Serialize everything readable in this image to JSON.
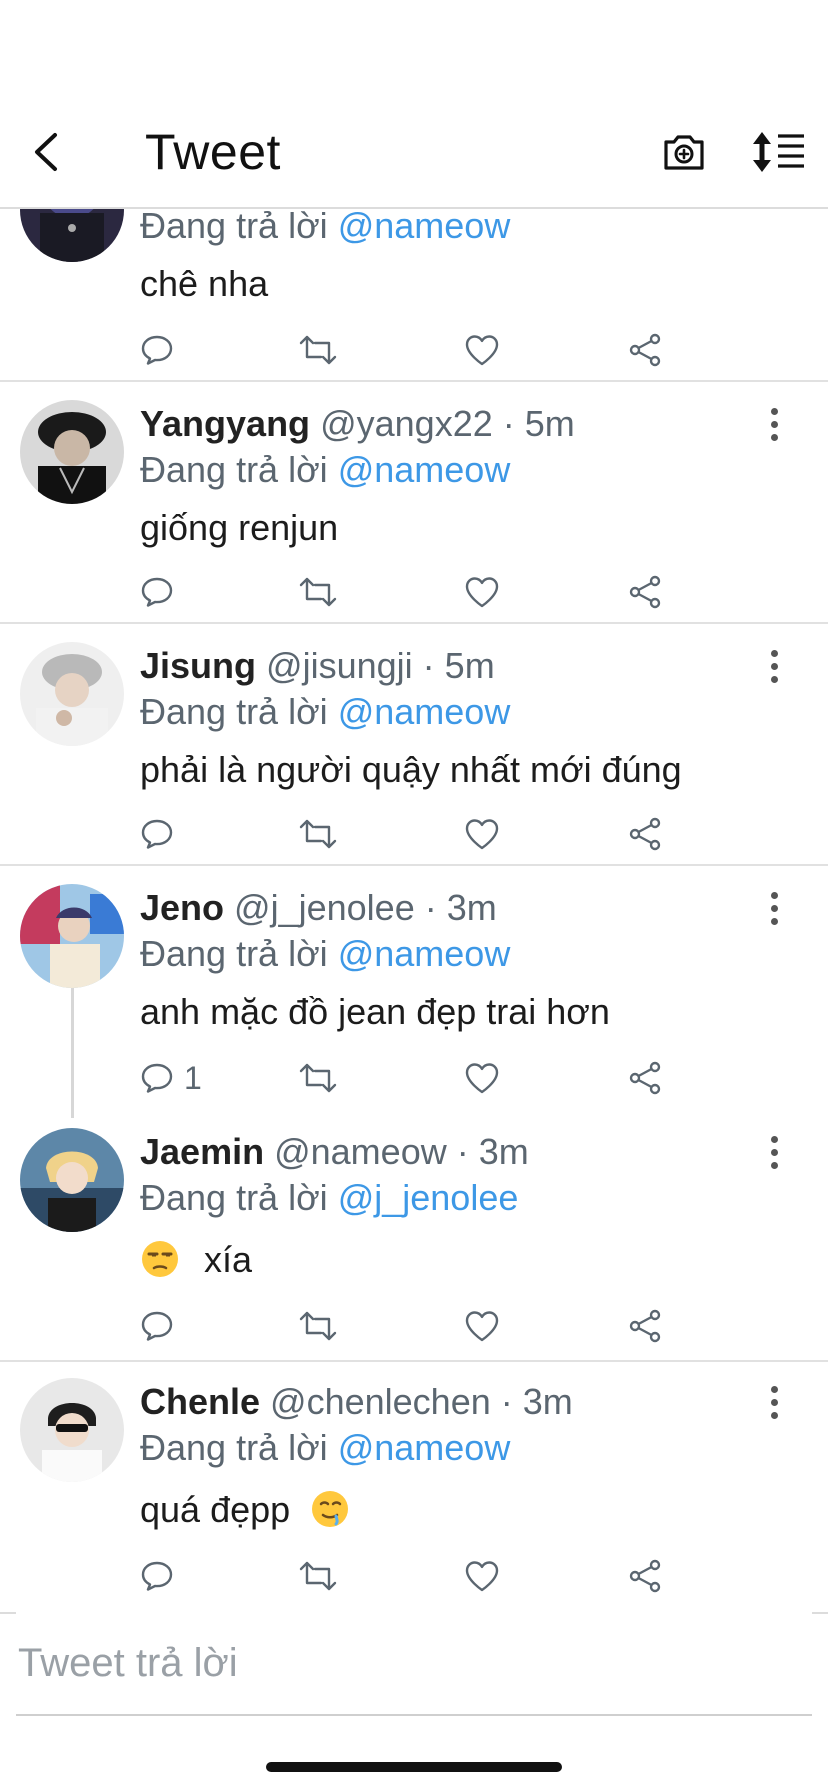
{
  "header": {
    "title": "Tweet"
  },
  "icons": {
    "back": "chevron-left-icon",
    "camera": "camera-plus-icon",
    "sort": "sort-list-icon"
  },
  "colors": {
    "accent": "#3d98e6",
    "muted": "#5b6670",
    "divider": "#e1e1e1"
  },
  "tweets": [
    {
      "name": "",
      "handle": "",
      "time": "",
      "reply_prefix": "Đang trả lời",
      "reply_to": "@nameow",
      "text": "chê nha",
      "replies": ""
    },
    {
      "name": "Yangyang",
      "handle": "@yangx22",
      "time": "5m",
      "reply_prefix": "Đang trả lời",
      "reply_to": "@nameow",
      "text": "giống renjun",
      "replies": ""
    },
    {
      "name": "Jisung",
      "handle": "@jisungji",
      "time": "5m",
      "reply_prefix": "Đang trả lời",
      "reply_to": "@nameow",
      "text": "phải là người quậy nhất mới đúng",
      "replies": ""
    },
    {
      "name": "Jeno",
      "handle": "@j_jenolee",
      "time": "3m",
      "reply_prefix": "Đang trả lời",
      "reply_to": "@nameow",
      "text": "anh mặc đồ jean đẹp trai hơn",
      "replies": "1"
    },
    {
      "name": "Jaemin",
      "handle": "@nameow",
      "time": "3m",
      "reply_prefix": "Đang trả lời",
      "reply_to": "@j_jenolee",
      "text": "xía",
      "emoji": "unamused-face-emoji",
      "replies": ""
    },
    {
      "name": "Chenle",
      "handle": "@chenlechen",
      "time": "3m",
      "reply_prefix": "Đang trả lời",
      "reply_to": "@nameow",
      "text": "quá đẹpp",
      "emoji": "drooling-face-emoji",
      "replies": ""
    }
  ],
  "separator": "·",
  "composer": {
    "placeholder": "Tweet trả lời"
  }
}
